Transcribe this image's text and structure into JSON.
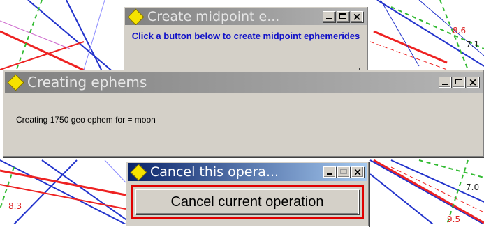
{
  "background": {
    "labels": [
      "8.6",
      "7.1",
      "8.3",
      "7.0",
      "9.5"
    ]
  },
  "create_window": {
    "title": "Create midpoint e...",
    "message": "Click a button below to create midpoint ephemerides"
  },
  "creating_window": {
    "title": "Creating ephems",
    "status": "Creating 1750 geo ephem for = moon"
  },
  "cancel_window": {
    "title": "Cancel this opera...",
    "button_label": "Cancel current operation"
  },
  "colors": {
    "accent_red": "#e00000",
    "message_blue": "#1010c8",
    "active_title": "#0a246a",
    "inactive_title": "#808080"
  },
  "icons": [
    "diamond-icon",
    "minimize-icon",
    "maximize-icon",
    "close-icon"
  ]
}
